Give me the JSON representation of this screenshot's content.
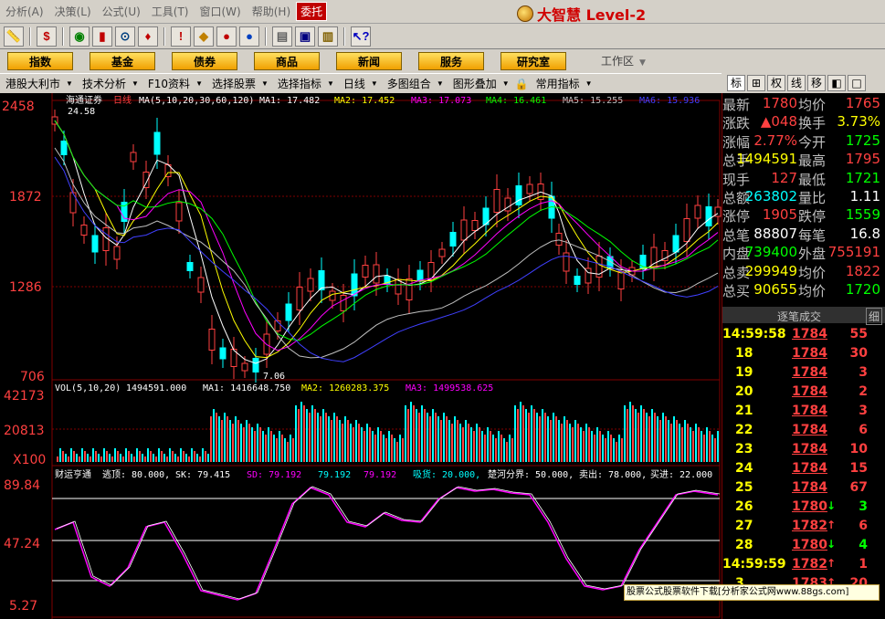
{
  "menu": {
    "items": [
      "分析(A)",
      "决策(L)",
      "公式(U)",
      "工具(T)",
      "窗口(W)",
      "帮助(H)",
      "委托"
    ],
    "brand": "大智慧 Level-2"
  },
  "nav": {
    "buttons": [
      "指数",
      "基金",
      "债券",
      "商品",
      "新闻",
      "服务",
      "研究室"
    ],
    "workspace": "工作区"
  },
  "subbar": [
    "港股大利市",
    "技术分析",
    "F10资料",
    "选择股票",
    "选择指标",
    "日线",
    "多图组合",
    "图形叠加",
    "常用指标"
  ],
  "rtabs": [
    "标",
    "",
    "权",
    "线",
    "移"
  ],
  "price_panel": {
    "ticks": [
      "2458",
      "1872",
      "1286",
      "706"
    ],
    "title_name": "海通证券",
    "title_period": "日线",
    "ma_label": "MA(5,10,20,30,60,120)",
    "ma_values": [
      {
        "label": "MA1: 17.482",
        "color": "#ffffff"
      },
      {
        "label": "MA2: 17.452",
        "color": "#ffff00"
      },
      {
        "label": "MA3: 17.073",
        "color": "#ff00ff"
      },
      {
        "label": "MA4: 16.461",
        "color": "#00ff00"
      },
      {
        "label": "MA5: 15.255",
        "color": "#c0c0c0"
      },
      {
        "label": "MA6: 15.936",
        "color": "#4040ff"
      }
    ],
    "high_mark": "24.58",
    "low_mark": "7.06"
  },
  "vol_panel": {
    "ticks": [
      "42173",
      "20813",
      "X100"
    ],
    "label": "VOL(5,10,20)",
    "value": "1494591.000",
    "ma1": "MA1: 1416648.750",
    "ma2": "MA2: 1260283.375",
    "ma3": "MA3: 1499538.625"
  },
  "ind_panel": {
    "ticks": [
      "89.84",
      "47.24",
      "5.27"
    ],
    "name": "财运亨通",
    "params": [
      {
        "label": "逃顶: 80.000,",
        "color": "#ffffff"
      },
      {
        "label": "SK: 79.415",
        "color": "#ffffff"
      },
      {
        "label": "SD: 79.192",
        "color": "#ff00ff"
      },
      {
        "label": "79.192",
        "color": "#00ffff"
      },
      {
        "label": "79.192",
        "color": "#ff00ff"
      },
      {
        "label": "吸货: 20.000,",
        "color": "#00ffff"
      },
      {
        "label": "楚河分界: 50.000,",
        "color": "#ffffff"
      },
      {
        "label": "卖出: 78.000,",
        "color": "#ffffff"
      },
      {
        "label": "买进: 22.000",
        "color": "#ffffff"
      }
    ]
  },
  "quotes": [
    {
      "l1": "最新",
      "v1": "1780",
      "c1": "#ff4040",
      "l2": "均价",
      "v2": "1765",
      "c2": "#ff4040"
    },
    {
      "l1": "涨跌",
      "v1": "▲048",
      "c1": "#ff4040",
      "l2": "换手",
      "v2": "3.73%",
      "c2": "#ffff00"
    },
    {
      "l1": "涨幅",
      "v1": "2.77%",
      "c1": "#ff4040",
      "l2": "今开",
      "v2": "1725",
      "c2": "#00ff00"
    },
    {
      "l1": "总手",
      "v1": "1494591",
      "c1": "#ffff00",
      "l2": "最高",
      "v2": "1795",
      "c2": "#ff4040"
    },
    {
      "l1": "现手",
      "v1": "127",
      "c1": "#ff4040",
      "l2": "最低",
      "v2": "1721",
      "c2": "#00ff00"
    },
    {
      "l1": "总额",
      "v1": "263802",
      "c1": "#00ffff",
      "l2": "量比",
      "v2": "1.11",
      "c2": "#ffffff"
    },
    {
      "l1": "涨停",
      "v1": "1905",
      "c1": "#ff4040",
      "l2": "跌停",
      "v2": "1559",
      "c2": "#00ff00"
    },
    {
      "l1": "总笔",
      "v1": "88807",
      "c1": "#ffffff",
      "l2": "每笔",
      "v2": "16.8",
      "c2": "#ffffff"
    },
    {
      "l1": "内盘",
      "v1": "739400",
      "c1": "#00ff00",
      "l2": "外盘",
      "v2": "755191",
      "c2": "#ff4040"
    },
    {
      "l1": "总卖",
      "v1": "299949",
      "c1": "#ffff00",
      "l2": "均价",
      "v2": "1822",
      "c2": "#ff4040"
    },
    {
      "l1": "总买",
      "v1": "90655",
      "c1": "#ffff00",
      "l2": "均价",
      "v2": "1720",
      "c2": "#00ff00"
    }
  ],
  "trades_header": {
    "title": "逐笔成交",
    "detail": "细"
  },
  "trades": [
    {
      "t": "14:59:58",
      "full": true,
      "p": "1784",
      "a": "",
      "v": "55",
      "vc": "#ff4040"
    },
    {
      "t": "18",
      "full": false,
      "p": "1784",
      "a": "",
      "v": "30",
      "vc": "#ff4040"
    },
    {
      "t": "19",
      "full": false,
      "p": "1784",
      "a": "",
      "v": "3",
      "vc": "#ff4040"
    },
    {
      "t": "20",
      "full": false,
      "p": "1784",
      "a": "",
      "v": "2",
      "vc": "#ff4040"
    },
    {
      "t": "21",
      "full": false,
      "p": "1784",
      "a": "",
      "v": "3",
      "vc": "#ff4040"
    },
    {
      "t": "22",
      "full": false,
      "p": "1784",
      "a": "",
      "v": "6",
      "vc": "#ff4040"
    },
    {
      "t": "23",
      "full": false,
      "p": "1784",
      "a": "",
      "v": "10",
      "vc": "#ff4040"
    },
    {
      "t": "24",
      "full": false,
      "p": "1784",
      "a": "",
      "v": "15",
      "vc": "#ff4040"
    },
    {
      "t": "25",
      "full": false,
      "p": "1784",
      "a": "",
      "v": "67",
      "vc": "#ff4040"
    },
    {
      "t": "26",
      "full": false,
      "p": "1780",
      "a": "↓",
      "ac": "#00ff00",
      "v": "3",
      "vc": "#00ff00"
    },
    {
      "t": "27",
      "full": false,
      "p": "1782",
      "a": "↑",
      "ac": "#ff4040",
      "v": "6",
      "vc": "#ff4040"
    },
    {
      "t": "28",
      "full": false,
      "p": "1780",
      "a": "↓",
      "ac": "#00ff00",
      "v": "4",
      "vc": "#00ff00"
    },
    {
      "t": "14:59:59",
      "full": true,
      "p": "1782",
      "a": "↑",
      "ac": "#ff4040",
      "v": "1",
      "vc": "#ff4040"
    },
    {
      "t": "3",
      "full": false,
      "p": "1783",
      "a": "↑",
      "ac": "#ff4040",
      "v": "20",
      "vc": "#ff4040"
    }
  ],
  "footer": "股票公式股票软件下载[分析家公式网www.88gs.com]",
  "colors": {
    "up": "#ff4040",
    "down": "#00ff00",
    "grid": "#800000",
    "accent": "#ffff00"
  }
}
